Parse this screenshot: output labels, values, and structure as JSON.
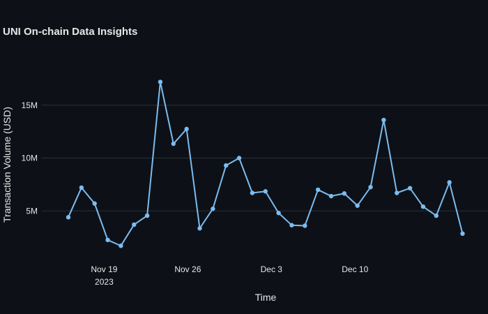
{
  "chart_data": {
    "type": "line",
    "title": "UNI On-chain Data Insights",
    "xlabel": "Time",
    "ylabel": "Transaction Volume (USD)",
    "x": [
      "2023-11-16",
      "2023-11-17",
      "2023-11-18",
      "2023-11-19",
      "2023-11-20",
      "2023-11-21",
      "2023-11-22",
      "2023-11-23",
      "2023-11-24",
      "2023-11-25",
      "2023-11-26",
      "2023-11-27",
      "2023-11-28",
      "2023-11-29",
      "2023-11-30",
      "2023-12-01",
      "2023-12-02",
      "2023-12-03",
      "2023-12-04",
      "2023-12-05",
      "2023-12-06",
      "2023-12-07",
      "2023-12-08",
      "2023-12-09",
      "2023-12-10",
      "2023-12-11",
      "2023-12-12",
      "2023-12-13",
      "2023-12-14",
      "2023-12-15",
      "2023-12-16",
      "2023-12-17",
      "2023-12-18",
      "2023-12-19"
    ],
    "values": [
      4400000,
      7200000,
      5700000,
      2250000,
      1700000,
      3700000,
      4550000,
      17200000,
      11350000,
      12750000,
      3350000,
      5200000,
      9300000,
      10000000,
      6700000,
      6850000,
      4800000,
      3650000,
      3600000,
      7000000,
      6400000,
      6650000,
      5500000,
      7250000,
      13600000,
      6700000,
      7150000,
      5400000,
      4550000,
      7700000,
      2850000
    ],
    "ylim": [
      0,
      20000000
    ],
    "yticks": [
      {
        "value": 5000000,
        "label": "5M"
      },
      {
        "value": 10000000,
        "label": "10M"
      },
      {
        "value": 15000000,
        "label": "15M"
      }
    ],
    "xticks": [
      {
        "value": "2023-11-19",
        "label": "Nov 19",
        "sublabel": "2023"
      },
      {
        "value": "2023-11-26",
        "label": "Nov 26",
        "sublabel": ""
      },
      {
        "value": "2023-12-03",
        "label": "Dec 3",
        "sublabel": ""
      },
      {
        "value": "2023-12-10",
        "label": "Dec 10",
        "sublabel": ""
      }
    ],
    "grid": true,
    "legend": "none",
    "colors": {
      "background": "#0d1117",
      "line": "#7cbcf0",
      "grid": "#2a2f38",
      "text": "#e6e6e6"
    }
  }
}
